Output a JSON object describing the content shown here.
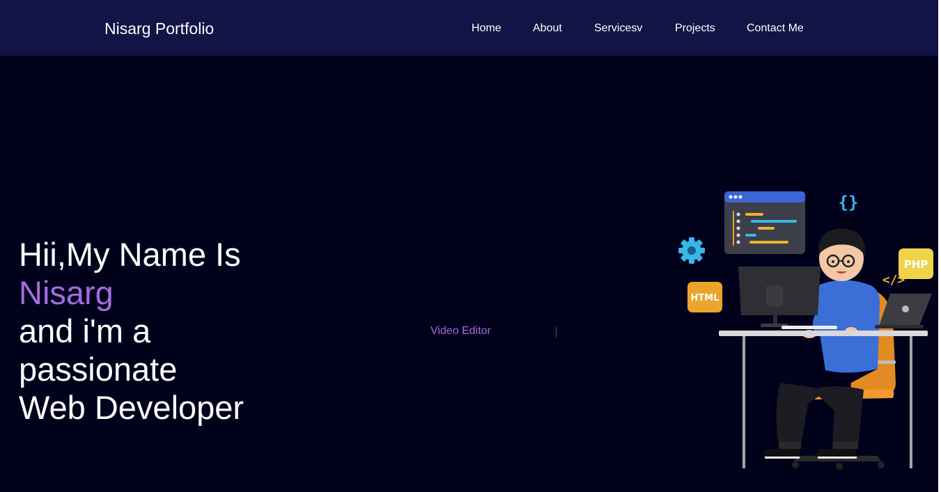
{
  "navbar": {
    "brand": "Nisarg Portfolio",
    "links": [
      "Home",
      "About",
      "Servicesv",
      "Projects",
      "Contact Me"
    ]
  },
  "hero": {
    "line1": "Hii,My Name Is",
    "name": "Nisarg",
    "line3": "and i'm a",
    "line4": "passionate",
    "line5": "Web Developer",
    "typed_text": "Video Editor"
  },
  "illustration": {
    "badges": [
      "HTML",
      "PHP",
      "{}",
      "</>"
    ],
    "icons": [
      "gear-icon",
      "code-window-icon",
      "laptop-icon",
      "monitor-icon"
    ]
  },
  "colors": {
    "navbar_bg": "#121445",
    "page_bg": "#01011c",
    "accent": "#a56bdc"
  }
}
